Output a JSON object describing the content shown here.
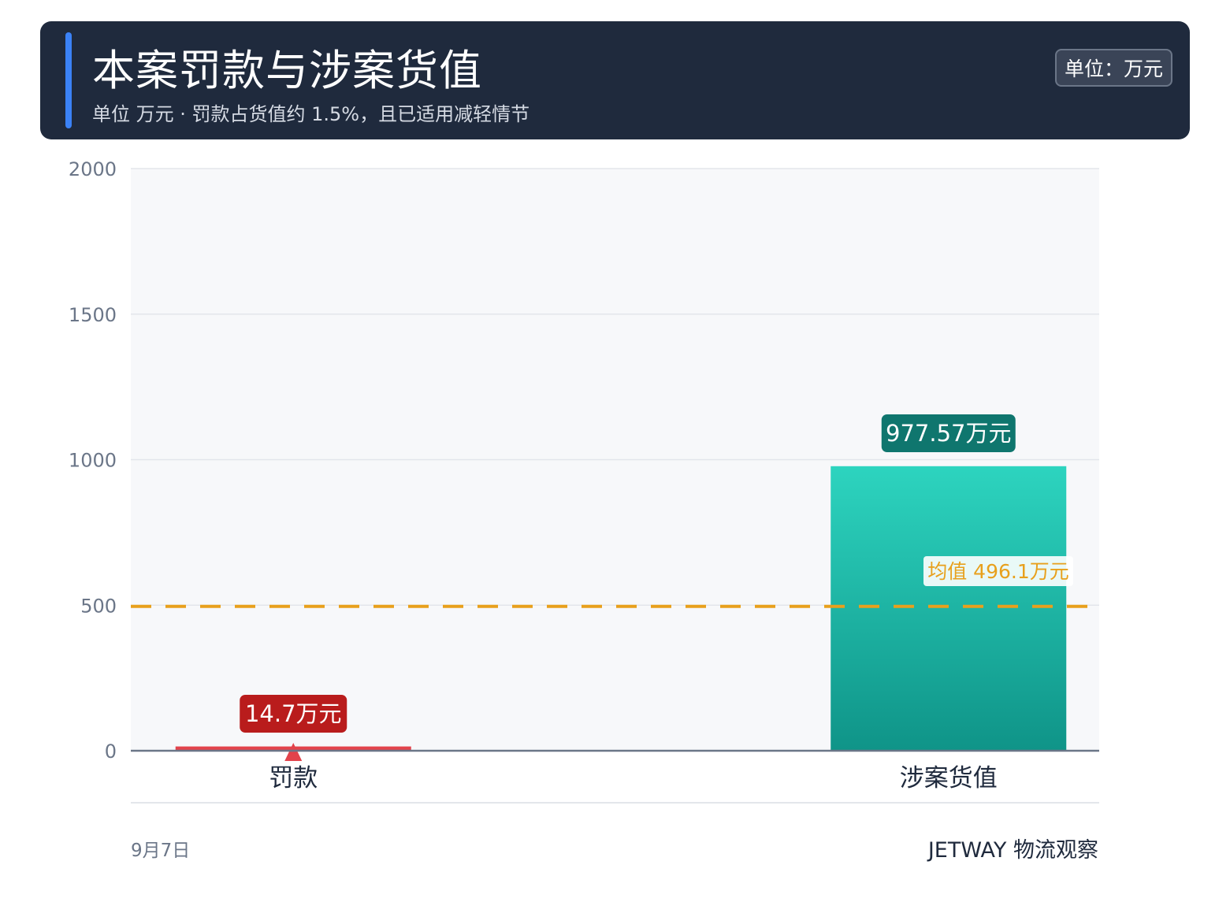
{
  "header": {
    "title": "本案罚款与涉案货值",
    "subtitle": "单位 万元 · 罚款占货值约 1.5%，且已适用减轻情节",
    "unit_badge": "单位：万元"
  },
  "colors": {
    "header_bg": "#1f2a3d",
    "accent": "#3b82f6",
    "fine": "#e2434b",
    "fine_label": "#b91c1c",
    "goods_top": "#2dd4bf",
    "goods_bottom": "#0f9488",
    "goods_label": "#0f766e",
    "mean_line": "#e8a01c"
  },
  "chart_data": {
    "type": "bar",
    "categories": [
      "罚款",
      "涉案货值"
    ],
    "values": [
      14.7,
      977.57
    ],
    "value_labels": [
      "14.7万元",
      "977.57万元"
    ],
    "yticks": [
      0,
      500,
      1000,
      1500,
      2000
    ],
    "ylim": [
      0,
      2000
    ],
    "mean": 496.1,
    "mean_label": "均值 496.1万元",
    "grid": true,
    "highlight_marker_on": "罚款"
  },
  "footer": {
    "date": "9月7日",
    "brand": "JETWAY 物流观察"
  }
}
